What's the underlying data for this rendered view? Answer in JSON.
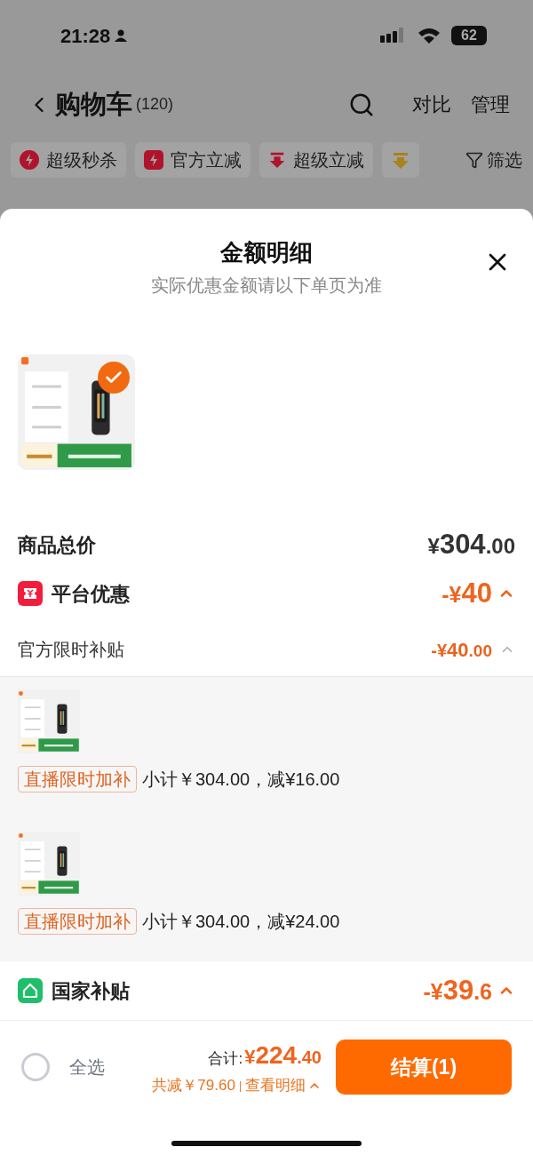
{
  "status_bar": {
    "time": "21:28",
    "battery": "62"
  },
  "nav": {
    "title": "购物车",
    "count": "(120)",
    "actions": [
      "对比",
      "管理"
    ]
  },
  "chips": [
    {
      "kind": "bolt",
      "label": "超级秒杀"
    },
    {
      "kind": "flash",
      "label": "官方立减"
    },
    {
      "kind": "arrow",
      "label": "超级立减"
    },
    {
      "kind": "gold"
    }
  ],
  "filter": {
    "label": "筛选"
  },
  "sheet": {
    "title": "金额明细",
    "subtitle": "实际优惠金额请以下单页为准",
    "product": {
      "selected": true
    },
    "total": {
      "label": "商品总价",
      "money": {
        "prefix": "¥",
        "integer": "304",
        "decimal": ".00"
      }
    },
    "sections": [
      {
        "kind": "platform",
        "label": "平台优惠",
        "money": {
          "prefix": "-¥",
          "integer": "40"
        },
        "items": [
          {
            "label": "官方限时补贴",
            "money": {
              "prefix": "-¥",
              "integer": "40",
              "decimal": ".00"
            },
            "details": [
              {
                "tag": "直播限时加补",
                "text": "小计￥304.00，减¥16.00"
              },
              {
                "tag": "直播限时加补",
                "text": "小计￥304.00，减¥24.00"
              }
            ]
          }
        ]
      },
      {
        "kind": "national",
        "label": "国家补贴",
        "money": {
          "prefix": "-¥",
          "integer": "39",
          "decimal": ".6"
        }
      }
    ]
  },
  "bottom_bar": {
    "select_all": {
      "label": "全选",
      "checked": false
    },
    "total_label": "合计:",
    "total": {
      "prefix": "¥",
      "integer": "224",
      "decimal": ".40"
    },
    "saved": "共减￥79.60",
    "separator": "|",
    "details_link": "查看明细",
    "checkout": "结算(1)"
  }
}
